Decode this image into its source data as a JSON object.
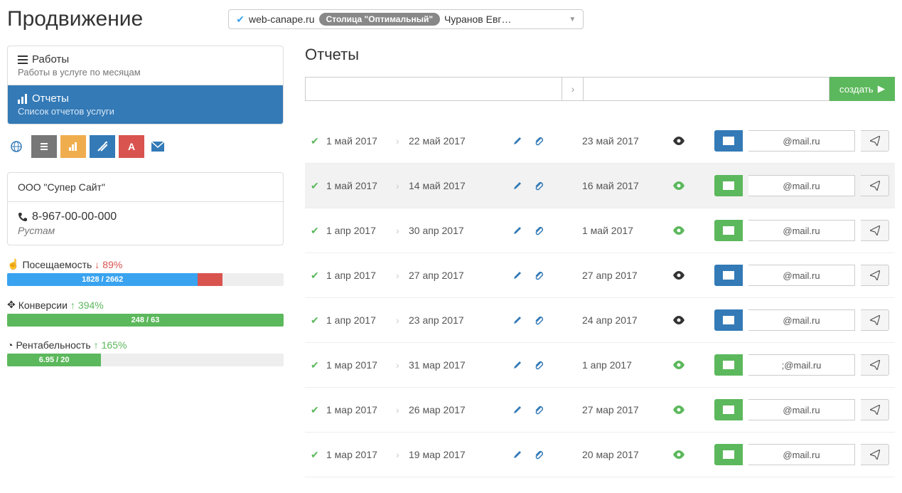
{
  "header": {
    "title": "Продвижение",
    "domain": "web-canape.ru",
    "tariff": "Столица \"Оптимальный\"",
    "manager": "Чуранов Евг…"
  },
  "sidebar": {
    "nav": [
      {
        "title": "Работы",
        "sub": "Работы в услуге по месяцам"
      },
      {
        "title": "Отчеты",
        "sub": "Список отчетов услуги"
      }
    ],
    "company": "ООО \"Супер Сайт\"",
    "phone": "8-967-00-00-000",
    "contact": "Рустам",
    "stats": {
      "visits": {
        "label": "Посещаемость",
        "pct": "89%",
        "value": "1828 / 2662",
        "blue_w": 69,
        "red_w": 9
      },
      "conv": {
        "label": "Конверсии",
        "pct": "394%",
        "value": "248 / 63",
        "green_w": 100
      },
      "rent": {
        "label": "Рентабельность",
        "pct": "165%",
        "value": "6.95 / 20",
        "green_w": 34
      }
    }
  },
  "main": {
    "title": "Отчеты",
    "create_label": "создать",
    "reports": [
      {
        "d1": "1 май 2017",
        "d2": "22 май 2017",
        "d3": "23 май 2017",
        "email": "@mail.ru",
        "env": "blue",
        "eye": "dark"
      },
      {
        "d1": "1 май 2017",
        "d2": "14 май 2017",
        "d3": "16 май 2017",
        "email": "@mail.ru",
        "env": "green",
        "eye": "green",
        "highlight": true
      },
      {
        "d1": "1 апр 2017",
        "d2": "30 апр 2017",
        "d3": "1 май 2017",
        "email": "@mail.ru",
        "env": "green",
        "eye": "green"
      },
      {
        "d1": "1 апр 2017",
        "d2": "27 апр 2017",
        "d3": "27 апр 2017",
        "email": "@mail.ru",
        "env": "blue",
        "eye": "dark"
      },
      {
        "d1": "1 апр 2017",
        "d2": "23 апр 2017",
        "d3": "24 апр 2017",
        "email": "@mail.ru",
        "env": "blue",
        "eye": "dark"
      },
      {
        "d1": "1 мар 2017",
        "d2": "31 мар 2017",
        "d3": "1 апр 2017",
        "email": ";@mail.ru",
        "env": "green",
        "eye": "green"
      },
      {
        "d1": "1 мар 2017",
        "d2": "26 мар 2017",
        "d3": "27 мар 2017",
        "email": "@mail.ru",
        "env": "green",
        "eye": "green"
      },
      {
        "d1": "1 мар 2017",
        "d2": "19 мар 2017",
        "d3": "20 мар 2017",
        "email": "@mail.ru",
        "env": "green",
        "eye": "green"
      }
    ]
  }
}
